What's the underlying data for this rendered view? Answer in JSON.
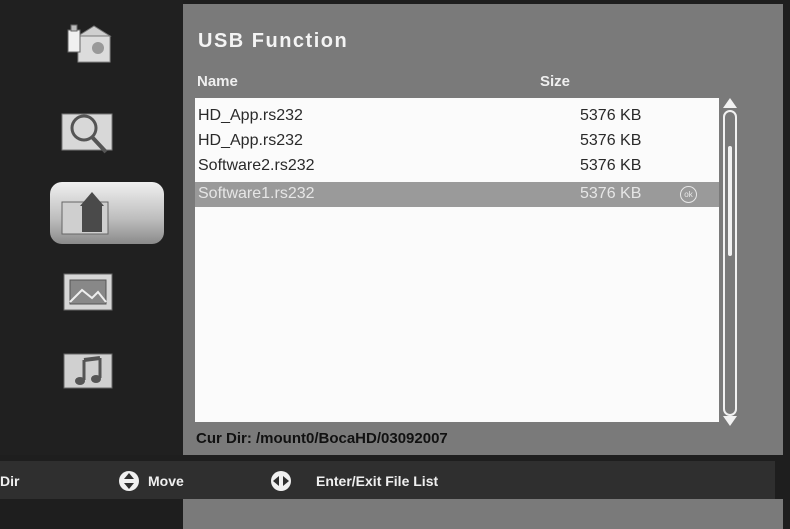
{
  "panel": {
    "title": "USB Function",
    "col_name": "Name",
    "col_size": "Size",
    "current_dir": "Cur Dir: /mount0/BocaHD/03092007"
  },
  "files": [
    {
      "name": "HD_App.rs232",
      "size": "5376 KB"
    },
    {
      "name": "HD_App.rs232",
      "size": "5376 KB"
    },
    {
      "name": "Software2.rs232",
      "size": "5376 KB"
    },
    {
      "name": "Software1.rs232",
      "size": "5376 KB",
      "badge": "ok"
    }
  ],
  "sidebar": {
    "items": [
      {
        "icon": "usb-icon"
      },
      {
        "icon": "search-icon"
      },
      {
        "icon": "upgrade-icon",
        "active": true
      },
      {
        "icon": "photo-icon"
      },
      {
        "icon": "music-icon"
      }
    ]
  },
  "help": {
    "dir_label": "Dir",
    "move_label": "Move",
    "enter_label": "Enter/Exit File List"
  },
  "colors": {
    "background": "#1e1e1e",
    "panel": "#7a7a7a",
    "list": "#fbfbfb",
    "selected": "#9a9a9a"
  }
}
